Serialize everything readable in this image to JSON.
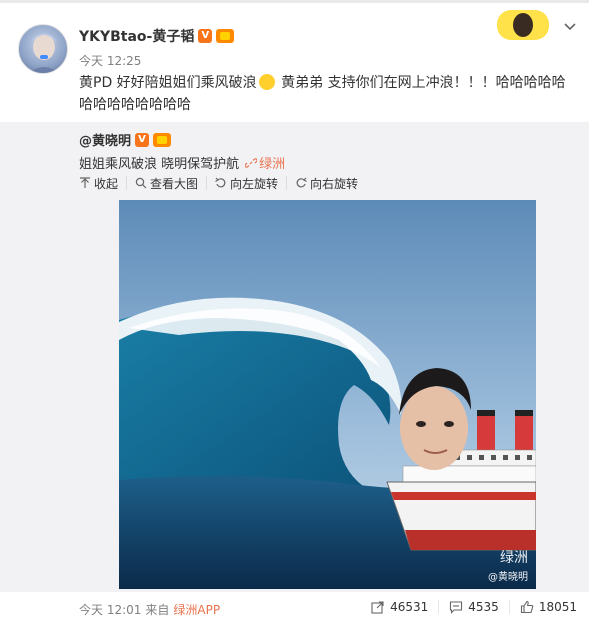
{
  "post": {
    "author": "YKYBtao-黄子韬",
    "time": "今天 12:25",
    "text_part1": "黄PD 好好陪姐姐们乘风破浪",
    "text_part2": " 黄弟弟 支持你们在网上冲浪！！！哈哈哈哈哈哈哈哈哈哈哈哈哈"
  },
  "repost": {
    "author": "@黄晓明",
    "text": "姐姐乘风破浪 晓明保驾护航",
    "link_label": "绿洲",
    "tools": {
      "collapse": "收起",
      "view_large": "查看大图",
      "rotate_left": "向左旋转",
      "rotate_right": "向右旋转"
    },
    "watermark": "绿洲",
    "watermark_handle": "@黄晓明"
  },
  "footer": {
    "time": "今天 12:01",
    "from": "来自",
    "source": "绿洲APP",
    "forward_count": "46531",
    "comment_count": "4535",
    "like_count": "18051"
  },
  "colors": {
    "accent": "#eb7350",
    "repost_bg": "#f2f2f5"
  }
}
